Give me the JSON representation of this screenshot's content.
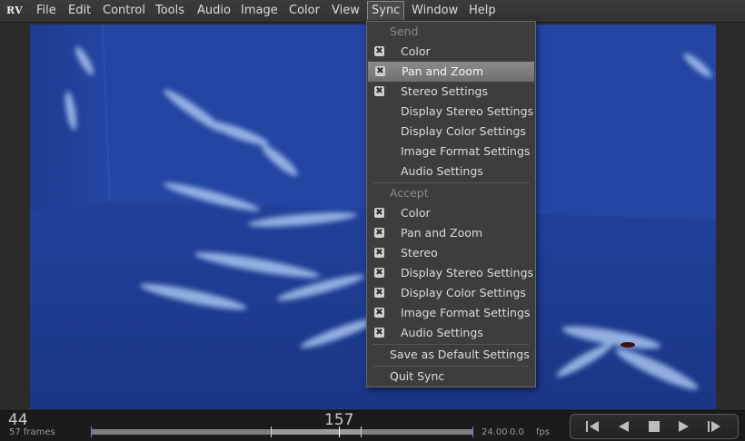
{
  "app": {
    "logo": "RV"
  },
  "menubar": {
    "items": [
      "File",
      "Edit",
      "Control",
      "Tools",
      "Audio",
      "Image",
      "Color",
      "View",
      "Sync",
      "Window",
      "Help"
    ],
    "active": "Sync"
  },
  "sync_menu": {
    "send_header": "Send",
    "send_items": [
      {
        "label": "Color",
        "checked": true
      },
      {
        "label": "Pan and Zoom",
        "checked": true,
        "highlighted": true
      },
      {
        "label": "Stereo Settings",
        "checked": true
      },
      {
        "label": "Display Stereo Settings",
        "checked": false
      },
      {
        "label": "Display Color Settings",
        "checked": false
      },
      {
        "label": "Image Format Settings",
        "checked": false
      },
      {
        "label": "Audio Settings",
        "checked": false
      }
    ],
    "accept_header": "Accept",
    "accept_items": [
      {
        "label": "Color",
        "checked": true
      },
      {
        "label": "Pan and Zoom",
        "checked": true
      },
      {
        "label": "Stereo",
        "checked": true
      },
      {
        "label": "Display Stereo Settings",
        "checked": true
      },
      {
        "label": "Display Color Settings",
        "checked": true
      },
      {
        "label": "Image Format Settings",
        "checked": true
      },
      {
        "label": "Audio Settings",
        "checked": true
      }
    ],
    "save_default": "Save as Default Settings",
    "quit": "Quit Sync"
  },
  "timeline": {
    "current_frame": "44",
    "frame_count": "57 frames",
    "center_frame": "157",
    "fps_target": "24.00",
    "fps_actual": "0.0",
    "fps_unit": "fps"
  },
  "transport": {
    "buttons": [
      "step-back-icon",
      "play-backward-icon",
      "stop-icon",
      "play-forward-icon",
      "step-forward-icon"
    ]
  },
  "colors": {
    "accent": "#8b8b8b",
    "viewport_blue": "#1f3f98"
  }
}
